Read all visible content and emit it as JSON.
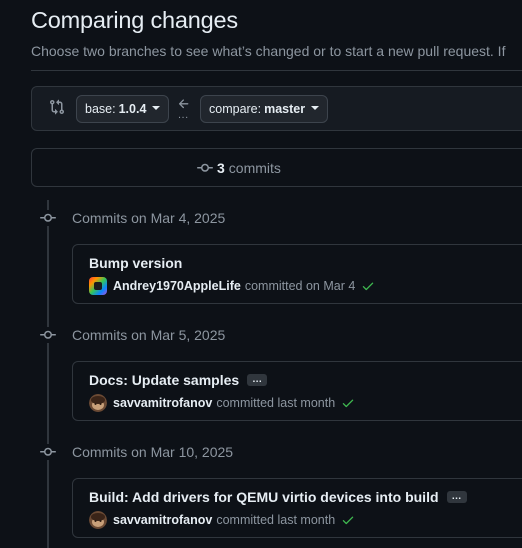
{
  "header": {
    "title": "Comparing changes",
    "subtitle": "Choose two branches to see what’s changed or to start a new pull request. If"
  },
  "range": {
    "base_key": "base:",
    "base_value": "1.0.4",
    "compare_key": "compare:",
    "compare_value": "master",
    "dots": "..."
  },
  "summary": {
    "commits_count": "3",
    "commits_label": "commits"
  },
  "groups": [
    {
      "date_label": "Commits on Mar 4, 2025",
      "commit": {
        "message": "Bump version",
        "author": "Andrey1970AppleLife",
        "action": "committed on Mar 4",
        "has_more": false
      }
    },
    {
      "date_label": "Commits on Mar 5, 2025",
      "commit": {
        "message": "Docs: Update samples",
        "author": "savvamitrofanov",
        "action": "committed last month",
        "has_more": true,
        "more_label": "…"
      }
    },
    {
      "date_label": "Commits on Mar 10, 2025",
      "commit": {
        "message": "Build: Add drivers for QEMU virtio devices into build",
        "author": "savvamitrofanov",
        "action": "committed last month",
        "has_more": true,
        "more_label": "…"
      }
    }
  ],
  "colors": {
    "background": "#0d1117",
    "border": "#30363d",
    "text_primary": "#e6edf3",
    "text_muted": "#8d96a0",
    "success": "#3fb950"
  }
}
